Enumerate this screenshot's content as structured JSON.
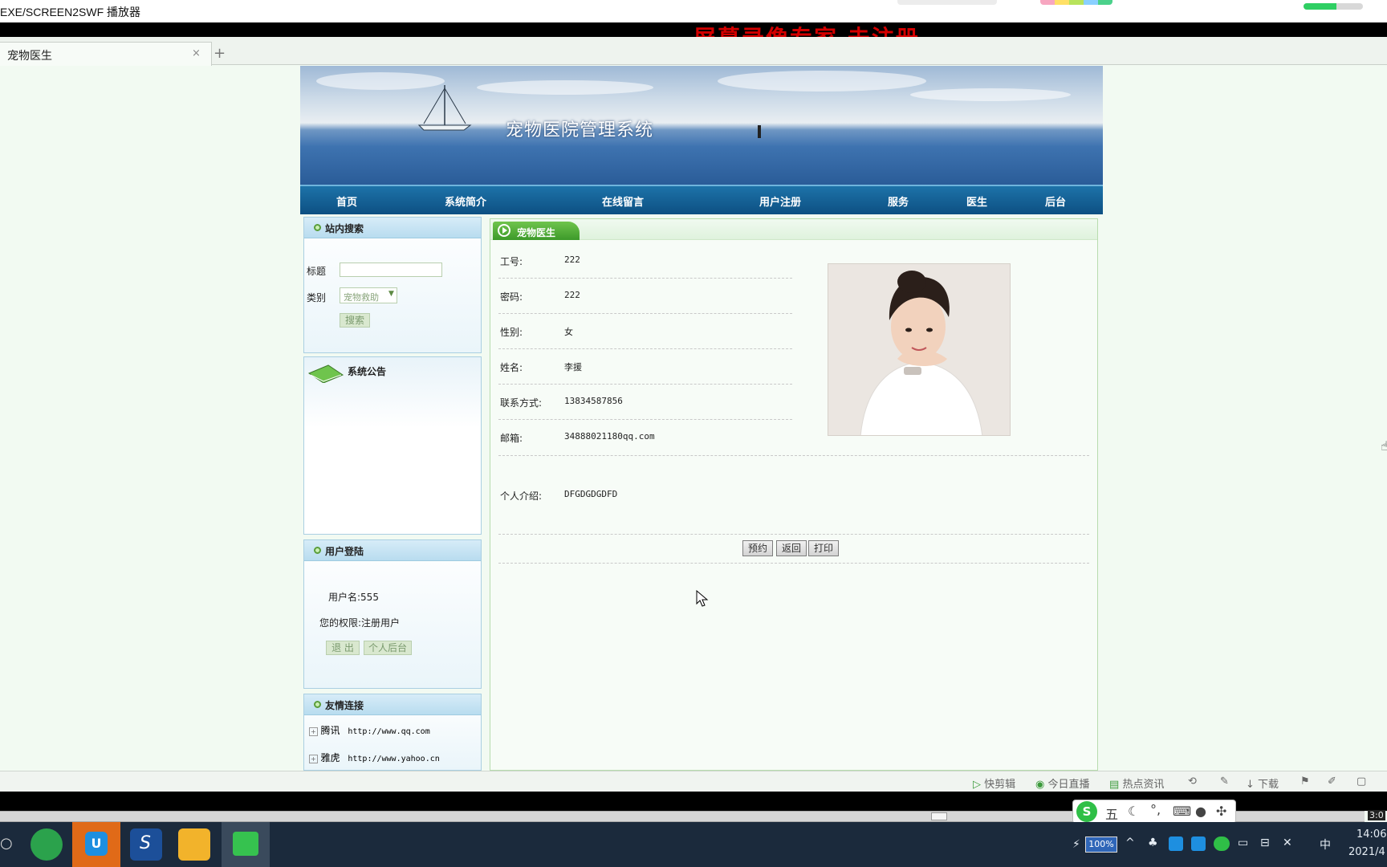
{
  "player": {
    "title": "EXE/SCREEN2SWF 播放器",
    "watermark": "屏幕录像专家  未注册",
    "volume_fraction": 0.55,
    "seek_time": "3:0"
  },
  "browser": {
    "tab_title": "宠物医生",
    "close_glyph": "×",
    "new_tab_glyph": "+"
  },
  "site": {
    "banner_title": "宠物医院管理系统",
    "nav": [
      "首页",
      "系统简介",
      "在线留言",
      "用户注册",
      "服务",
      "医生",
      "后台"
    ]
  },
  "sidebar": {
    "search": {
      "title": "站内搜索",
      "title_label": "标题",
      "title_value": "",
      "category_label": "类别",
      "category_selected": "宠物救助",
      "search_button": "搜索"
    },
    "notice": {
      "title": "系统公告"
    },
    "login": {
      "title": "用户登陆",
      "username_text": "用户名:555",
      "role_text": "您的权限:注册用户",
      "logout_button": "退 出",
      "personal_button": "个人后台"
    },
    "links": {
      "title": "友情连接",
      "items": [
        {
          "name": "腾讯",
          "url": "http://www.qq.com"
        },
        {
          "name": "雅虎",
          "url": "http://www.yahoo.cn"
        }
      ]
    }
  },
  "main": {
    "section_title": "宠物医生",
    "fields": [
      {
        "label": "工号:",
        "value": "222"
      },
      {
        "label": "密码:",
        "value": "222"
      },
      {
        "label": "性别:",
        "value": "女"
      },
      {
        "label": "姓名:",
        "value": "李援"
      },
      {
        "label": "联系方式:",
        "value": "13834587856"
      },
      {
        "label": "邮箱:",
        "value": "34888021180qq.com"
      }
    ],
    "intro_label": "个人介绍:",
    "intro_value": "DFGDGDGDFD",
    "buttons": {
      "book": "预约",
      "back": "返回",
      "print": "打印"
    }
  },
  "statusbar": {
    "items": [
      "快剪辑",
      "今日直播",
      "热点资讯",
      "下载"
    ]
  },
  "ime": {
    "mode": "五"
  },
  "taskbar": {
    "battery": "100%",
    "input_lang": "中",
    "time": "14:06",
    "date": "2021/4"
  },
  "colors": {
    "nav_blue": "#0d4f82",
    "accent_green": "#3d9a2a",
    "watermark_red": "#d40000"
  }
}
